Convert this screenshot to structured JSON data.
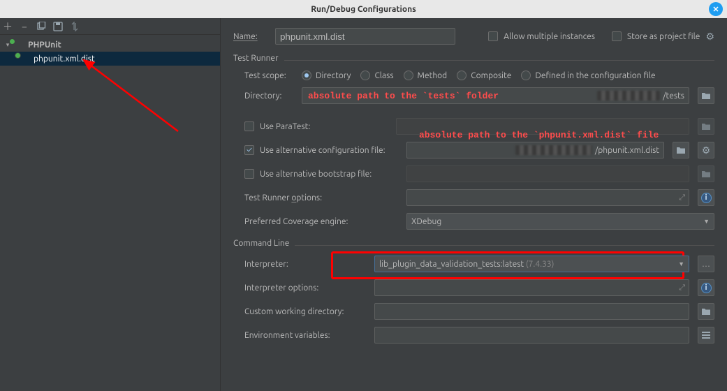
{
  "window": {
    "title": "Run/Debug Configurations"
  },
  "tree": {
    "root_label": "PHPUnit",
    "child_label": "phpunit.xml.dist"
  },
  "form": {
    "name_label": "Name:",
    "name_value": "phpunit.xml.dist",
    "allow_multiple": "Allow multiple instances",
    "store_as_project": "Store as project file"
  },
  "test_runner": {
    "title": "Test Runner",
    "scope_label": "Test scope:",
    "scope_options": {
      "directory": "Directory",
      "class": "Class",
      "method": "Method",
      "composite": "Composite",
      "defined": "Defined in the configuration file"
    },
    "directory_label": "Directory:",
    "directory_suffix": "/tests",
    "paratest_label": "Use ParaTest:",
    "alt_config_label": "Use alternative configuration file:",
    "alt_config_suffix": "/phpunit.xml.dist",
    "alt_bootstrap_label": "Use alternative bootstrap file:",
    "runner_options_label": "Test Runner options:",
    "coverage_engine_label": "Preferred Coverage engine:",
    "coverage_engine_value": "XDebug"
  },
  "command_line": {
    "title": "Command Line",
    "interpreter_label": "Interpreter:",
    "interpreter_value": "lib_plugin_data_validation_tests:latest",
    "interpreter_version": "(7.4.33)",
    "interpreter_options_label": "Interpreter options:",
    "working_dir_label": "Custom working directory:",
    "env_vars_label": "Environment variables:"
  },
  "annotations": {
    "tests_path": "absolute path to the `tests` folder",
    "config_path": "absolute path to the `phpunit.xml.dist` file"
  }
}
